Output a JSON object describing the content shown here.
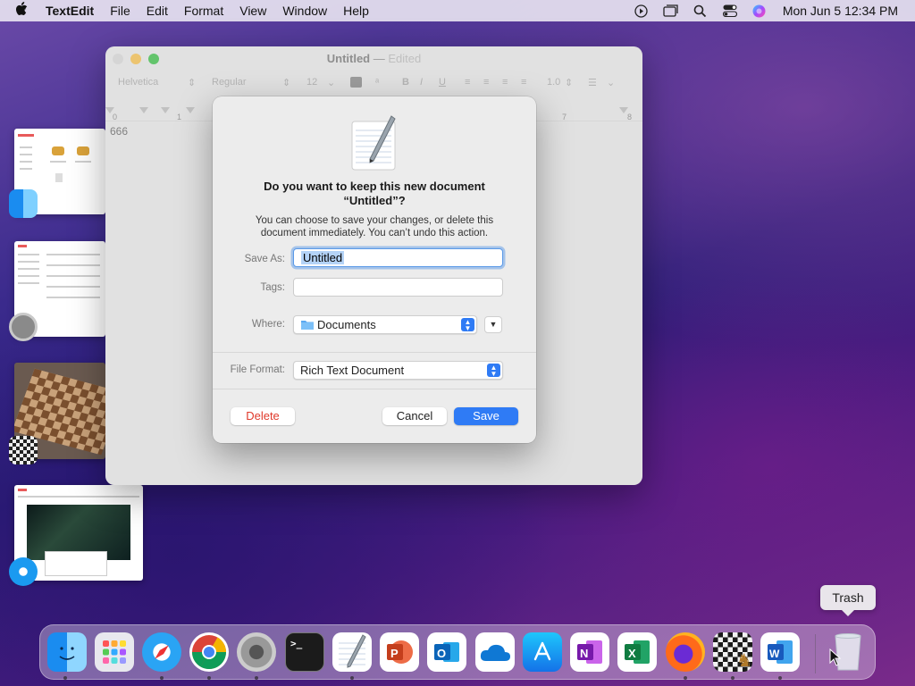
{
  "menubar": {
    "app_name": "TextEdit",
    "items": [
      "File",
      "Edit",
      "Format",
      "View",
      "Window",
      "Help"
    ],
    "clock": "Mon Jun 5  12:34 PM",
    "status_icons": [
      "play-circle-icon",
      "screen-mirror-icon",
      "spotlight-search-icon",
      "control-center-icon",
      "siri-icon"
    ]
  },
  "editor": {
    "title": "Untitled",
    "title_separator": "—",
    "edited_label": "Edited",
    "font_family": "Helvetica",
    "font_style": "Regular",
    "font_size": "12",
    "line_spacing": "1.0",
    "ruler_numbers": [
      "0",
      "1",
      "7",
      "8"
    ],
    "document_text": "666"
  },
  "dialog": {
    "question_line1": "Do you want to keep this new document",
    "question_line2": "“Untitled”?",
    "description": "You can choose to save your changes, or delete this document immediately. You can’t undo this action.",
    "save_as_label": "Save As:",
    "save_as_value": "Untitled",
    "tags_label": "Tags:",
    "tags_value": "",
    "where_label": "Where:",
    "where_value": "Documents",
    "file_format_label": "File Format:",
    "file_format_value": "Rich Text Document",
    "delete_label": "Delete",
    "cancel_label": "Cancel",
    "save_label": "Save"
  },
  "dock": {
    "apps": [
      "Finder",
      "Launchpad",
      "Safari",
      "Chrome",
      "System Settings",
      "Terminal",
      "TextEdit",
      "PowerPoint",
      "Outlook",
      "OneDrive",
      "App Store",
      "OneNote",
      "Excel",
      "Firefox",
      "Chess",
      "Word"
    ],
    "trash_tooltip": "Trash"
  },
  "colors": {
    "accent": "#2f7bf5",
    "destructive": "#e0392b"
  }
}
